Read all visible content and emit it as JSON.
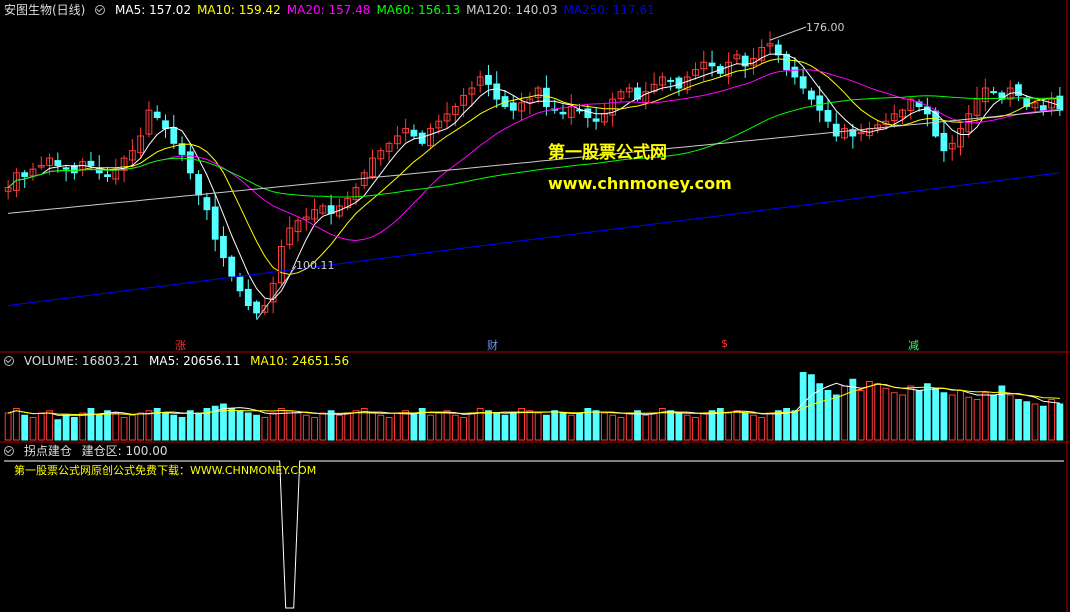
{
  "header": {
    "title": "安图生物(日线)",
    "ma_items": [
      {
        "label": "MA5: 157.02",
        "color": "#ffffff"
      },
      {
        "label": "MA10: 159.42",
        "color": "#ffff00"
      },
      {
        "label": "MA20: 157.48",
        "color": "#ff00ff"
      },
      {
        "label": "MA60: 156.13",
        "color": "#00ff00"
      },
      {
        "label": "MA120: 140.03",
        "color": "#cccccc"
      },
      {
        "label": "MA250: 117.61",
        "color": "#0000ff"
      }
    ]
  },
  "volume_header": {
    "title": "VOLUME: 16803.21",
    "ma5": "MA5: 20656.11",
    "ma10": "MA10: 24651.56"
  },
  "indicator_header": {
    "title": "拐点建仓",
    "value": "建仓区: 100.00"
  },
  "watermark": {
    "line1": "第一股票公式网",
    "line2": "www.chnmoney.com"
  },
  "indicator_note": "第一股票公式网原创公式免费下载：WWW.CHNMONEY.COM",
  "annotations": {
    "high": "176.00",
    "low": "100.11"
  },
  "markers": [
    {
      "label": "涨",
      "color": "#ff3333"
    },
    {
      "label": "财",
      "color": "#6699ff"
    },
    {
      "label": "$",
      "color": "#ff3333"
    },
    {
      "label": "减",
      "color": "#33ff66"
    }
  ],
  "colors": {
    "up": "#ff3b3b",
    "down": "#54ffff",
    "axis": "#b00000"
  },
  "chart_data": {
    "type": "candlestick",
    "ohlc_sample_closes": [
      136,
      140,
      139,
      141,
      142,
      144,
      142,
      141,
      140,
      143,
      142,
      140,
      139,
      141,
      144,
      146,
      150,
      157,
      155,
      152,
      148,
      145,
      140,
      134,
      130,
      122,
      117,
      112,
      108,
      104,
      102,
      104,
      110,
      120,
      125,
      127,
      128,
      130,
      131,
      129,
      131,
      133,
      136,
      140,
      144,
      146,
      148,
      150,
      152,
      150,
      148,
      152,
      154,
      156,
      158,
      161,
      163,
      166,
      164,
      160,
      158,
      157,
      159,
      160,
      163,
      158,
      157,
      156,
      158,
      157,
      155,
      154,
      156,
      160,
      162,
      163,
      160,
      162,
      164,
      166,
      165,
      163,
      166,
      168,
      170,
      169,
      167,
      170,
      172,
      169,
      171,
      174,
      175,
      172,
      168,
      166,
      163,
      160,
      157,
      154,
      150,
      152,
      150,
      151,
      152,
      153,
      154,
      156,
      157,
      160,
      158,
      156,
      150,
      146,
      148,
      152,
      156,
      160,
      163,
      162,
      160,
      163,
      161,
      158,
      159,
      157,
      160,
      157
    ],
    "price_range": [
      96,
      182
    ],
    "high_label": 176.0,
    "low_label": 100.11,
    "ma_series": [
      {
        "name": "MA5",
        "color": "#ffffff"
      },
      {
        "name": "MA10",
        "color": "#ffff00"
      },
      {
        "name": "MA20",
        "color": "#ff00ff"
      },
      {
        "name": "MA60",
        "color": "#00ff00"
      },
      {
        "name": "MA120",
        "color": "#cccccc"
      },
      {
        "name": "MA250",
        "color": "#0000ff"
      }
    ],
    "ma120_endpoints": [
      129,
      157
    ],
    "ma250_endpoints": [
      104,
      140
    ],
    "volume": {
      "values": [
        12,
        14,
        11,
        10,
        12,
        13,
        9,
        11,
        10,
        12,
        14,
        11,
        13,
        12,
        10,
        11,
        12,
        13,
        14,
        12,
        11,
        10,
        13,
        12,
        14,
        15,
        16,
        14,
        13,
        12,
        11,
        10,
        12,
        14,
        13,
        12,
        11,
        10,
        12,
        13,
        11,
        12,
        13,
        14,
        12,
        11,
        10,
        12,
        13,
        12,
        14,
        11,
        12,
        13,
        11,
        10,
        12,
        14,
        13,
        12,
        11,
        12,
        14,
        13,
        12,
        11,
        13,
        12,
        11,
        12,
        14,
        13,
        12,
        11,
        10,
        12,
        13,
        11,
        12,
        14,
        13,
        12,
        11,
        10,
        12,
        13,
        14,
        12,
        13,
        12,
        11,
        10,
        12,
        13,
        14,
        13,
        30,
        29,
        25,
        22,
        20,
        24,
        27,
        22,
        26,
        25,
        23,
        21,
        20,
        24,
        22,
        25,
        23,
        21,
        20,
        22,
        19,
        18,
        21,
        20,
        24,
        20,
        18,
        17,
        16,
        15,
        18,
        16
      ],
      "range": [
        0,
        32
      ],
      "ma5_color": "#ffffff",
      "ma10_color": "#ffff00"
    },
    "indicator": {
      "baseline": 100,
      "spike_index": 34,
      "spike_value": 0
    }
  }
}
